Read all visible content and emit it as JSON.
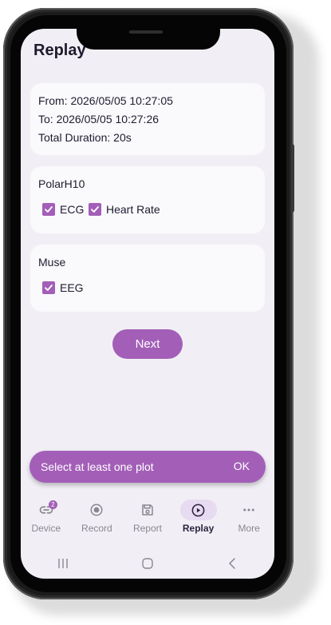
{
  "page": {
    "title": "Replay"
  },
  "session": {
    "from": "From: 2026/05/05 10:27:05",
    "to": "To: 2026/05/05 10:27:26",
    "duration": "Total Duration: 20s"
  },
  "devices": [
    {
      "name": "PolarH10",
      "signals": [
        {
          "label": "ECG",
          "checked": true
        },
        {
          "label": "Heart Rate",
          "checked": true
        }
      ]
    },
    {
      "name": "Muse",
      "signals": [
        {
          "label": "EEG",
          "checked": true
        }
      ]
    }
  ],
  "next_label": "Next",
  "snackbar": {
    "message": "Select at least one plot",
    "action": "OK"
  },
  "nav": {
    "items": [
      {
        "label": "Device",
        "icon": "link-icon",
        "badge": "2"
      },
      {
        "label": "Record",
        "icon": "record-icon"
      },
      {
        "label": "Report",
        "icon": "save-icon"
      },
      {
        "label": "Replay",
        "icon": "play-circle-icon",
        "active": true
      },
      {
        "label": "More",
        "icon": "more-horizontal-icon"
      }
    ]
  },
  "colors": {
    "accent": "#a35fb8",
    "background": "#f1eff5",
    "card": "#faf9fc",
    "nav_active_pill": "#e6dbf0"
  }
}
